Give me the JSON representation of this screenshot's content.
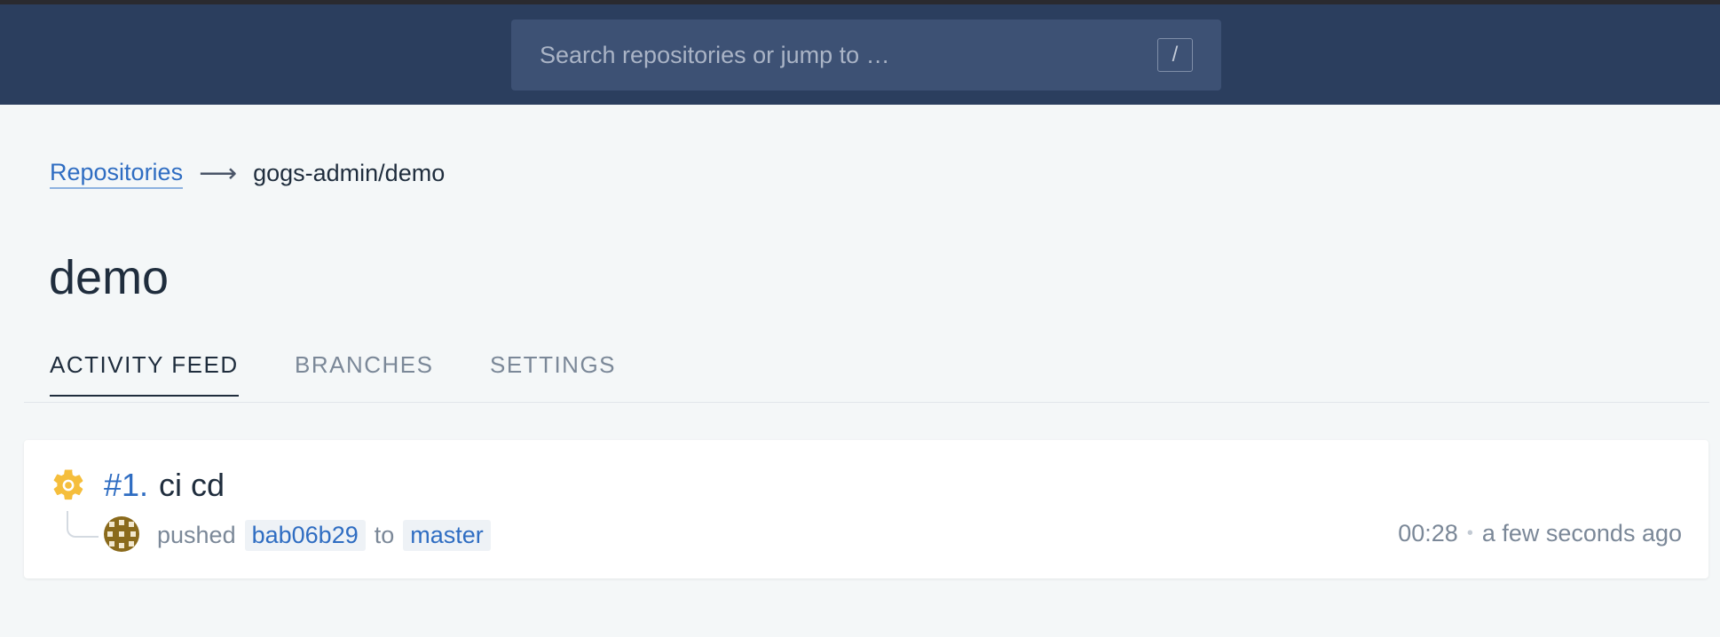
{
  "search": {
    "placeholder": "Search repositories or jump to …",
    "shortcut": "/"
  },
  "breadcrumb": {
    "root": "Repositories",
    "arrow": "⟶",
    "current": "gogs-admin/demo"
  },
  "page": {
    "title": "demo"
  },
  "tabs": [
    {
      "label": "ACTIVITY FEED",
      "active": true
    },
    {
      "label": "BRANCHES",
      "active": false
    },
    {
      "label": "SETTINGS",
      "active": false
    }
  ],
  "build": {
    "status_icon": "gear-icon",
    "number": "#1.",
    "message": "ci cd",
    "action": "pushed",
    "commit": "bab06b29",
    "preposition": "to",
    "branch": "master",
    "duration": "00:28",
    "separator": "•",
    "time_ago": "a few seconds ago"
  },
  "colors": {
    "header_bg": "#2b3e5e",
    "link": "#2f6dc2",
    "status_running": "#f5be3c"
  }
}
